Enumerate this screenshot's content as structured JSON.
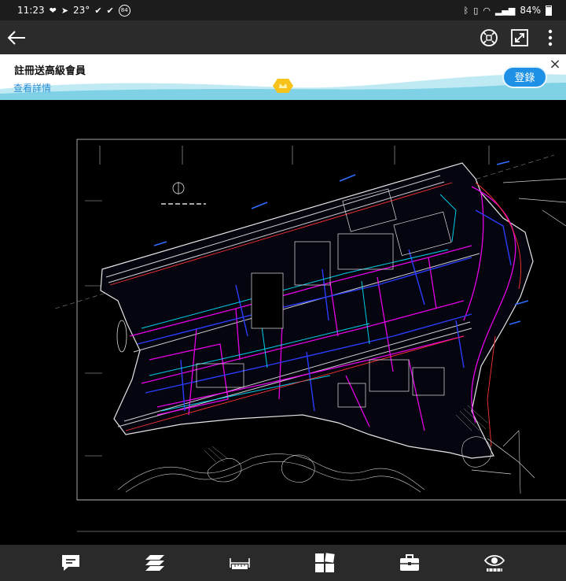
{
  "status_bar": {
    "time": "11:23",
    "temperature": "23°",
    "notification_badge": "84",
    "battery_percent": "84%"
  },
  "toolbar": {
    "back_icon": "arrow-left-icon",
    "icons": [
      "zoom-fit-icon",
      "fullscreen-icon",
      "more-vertical-icon"
    ]
  },
  "banner": {
    "title": "註冊送高級會員",
    "link": "查看詳情",
    "login_label": "登錄",
    "close_label": "×"
  },
  "drawing": {
    "accent_colors": [
      "#ff00ff",
      "#2233ff",
      "#00e5ff",
      "#ff3333",
      "#ffffff"
    ]
  },
  "bottom_bar": {
    "icons": [
      "comment-icon",
      "layers-icon",
      "measure-ruler-icon",
      "blocks-icon",
      "toolbox-icon",
      "view-eye-icon"
    ]
  }
}
